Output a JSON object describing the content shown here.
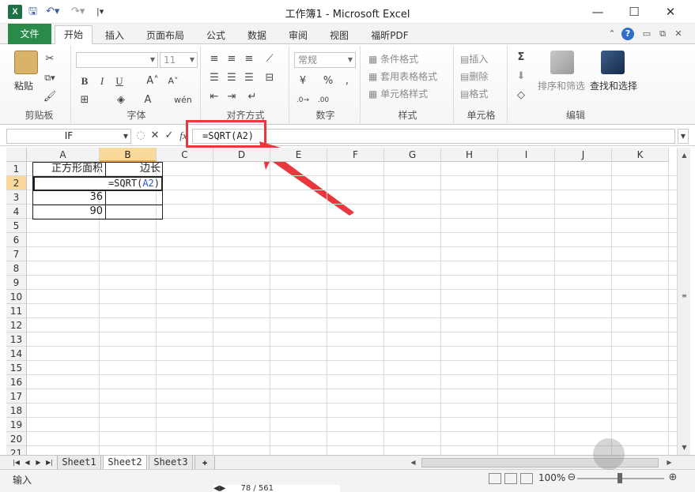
{
  "window": {
    "title": "工作簿1 - Microsoft Excel",
    "app_icon": "X"
  },
  "qat": {
    "save_icon": "save-icon",
    "undo_icon": "undo-icon",
    "redo_icon": "redo-icon"
  },
  "ribbon_tabs": {
    "file": "文件",
    "tabs": [
      "开始",
      "插入",
      "页面布局",
      "公式",
      "数据",
      "审阅",
      "视图",
      "福昕PDF"
    ]
  },
  "ribbon": {
    "clipboard": {
      "label": "剪贴板",
      "paste": "粘贴"
    },
    "font": {
      "label": "字体",
      "size": "11",
      "bold": "B",
      "italic": "I",
      "underline": "U"
    },
    "alignment": {
      "label": "对齐方式"
    },
    "number": {
      "label": "数字",
      "format": "常规"
    },
    "styles": {
      "label": "样式",
      "conditional": "条件格式",
      "table": "套用表格格式",
      "cell": "单元格样式"
    },
    "cells": {
      "label": "单元格",
      "insert": "插入",
      "delete": "删除",
      "format": "格式"
    },
    "editing": {
      "label": "编辑",
      "sort": "排序和筛选",
      "find": "查找和选择",
      "sigma": "Σ"
    }
  },
  "formula_bar": {
    "name_box": "IF",
    "fx": "fx",
    "formula": "=SQRT(A2)"
  },
  "grid": {
    "columns": [
      "A",
      "B",
      "C",
      "D",
      "E",
      "F",
      "G",
      "H",
      "I",
      "J",
      "K"
    ],
    "rows": [
      "1",
      "2",
      "3",
      "4",
      "5",
      "6",
      "7",
      "8",
      "9",
      "10",
      "11",
      "12",
      "13",
      "14",
      "15",
      "16",
      "17",
      "18",
      "19",
      "20",
      "21"
    ],
    "cells": {
      "A1": "正方形面积",
      "B1": "边长",
      "B2_prefix": "=SQRT(",
      "B2_ref": "A2",
      "B2_suffix": ")",
      "A3": "36",
      "A4": "90"
    }
  },
  "sheets": [
    "Sheet1",
    "Sheet2",
    "Sheet3"
  ],
  "active_sheet": "Sheet2",
  "status": {
    "mode": "输入",
    "zoom": "100%",
    "page": "78 / 561"
  },
  "colors": {
    "file_tab": "#2a8a4a",
    "highlight": "#e8383d",
    "selected_header": "#f9d99c",
    "ref": "#2f55c8"
  }
}
